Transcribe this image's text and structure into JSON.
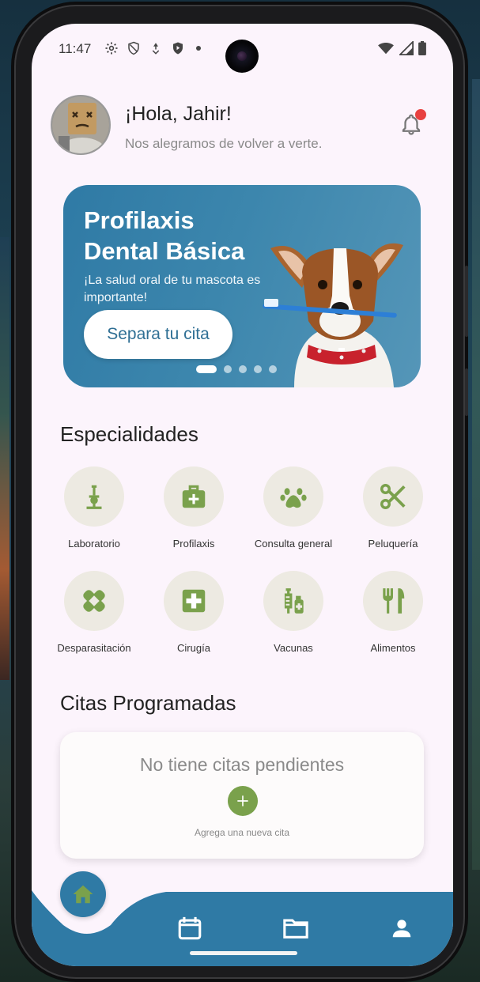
{
  "status_bar": {
    "time": "11:47",
    "left_icons": [
      "settings-icon",
      "shield-icon",
      "location-icon",
      "play-shield-icon"
    ],
    "right_icons": [
      "wifi-icon",
      "signal-icon",
      "battery-icon"
    ]
  },
  "header": {
    "greeting": "¡Hola, Jahir!",
    "subtitle": "Nos alegramos de volver a verte.",
    "has_notification": true
  },
  "banner": {
    "title": "Profilaxis Dental Básica",
    "subtitle": "¡La salud oral de tu mascota es importante!",
    "button_label": "Separa tu cita",
    "slides": 5,
    "active_slide": 1
  },
  "specialties": {
    "title": "Especialidades",
    "items": [
      {
        "label": "Laboratorio",
        "icon": "microscope-icon"
      },
      {
        "label": "Profilaxis",
        "icon": "medical-kit-icon"
      },
      {
        "label": "Consulta general",
        "icon": "paw-icon"
      },
      {
        "label": "Peluquería",
        "icon": "scissors-icon"
      },
      {
        "label": "Desparasitación",
        "icon": "bandage-icon"
      },
      {
        "label": "Cirugía",
        "icon": "medical-cross-icon"
      },
      {
        "label": "Vacunas",
        "icon": "syringe-vial-icon"
      },
      {
        "label": "Alimentos",
        "icon": "utensils-icon"
      }
    ]
  },
  "appointments": {
    "title": "Citas Programadas",
    "empty_message": "No tiene citas pendientes",
    "add_hint": "Agrega una nueva cita"
  },
  "bottom_nav": {
    "items": [
      "home-icon",
      "calendar-icon",
      "folder-icon",
      "user-icon"
    ],
    "active": "home-icon"
  },
  "colors": {
    "primary": "#2f7aa5",
    "accent_green": "#7aa14c",
    "background": "#fcf4fc",
    "icon_circle": "#edeae2",
    "notification": "#e84040"
  }
}
